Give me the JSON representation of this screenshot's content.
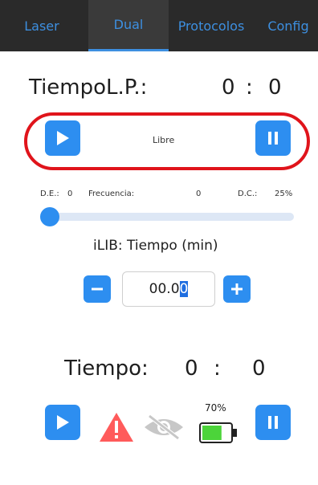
{
  "tabs": [
    {
      "label": "Laser",
      "active": false
    },
    {
      "label": "Dual",
      "active": true
    },
    {
      "label": "Protocolos",
      "active": false
    },
    {
      "label": "Config",
      "active": false
    }
  ],
  "timer_lp": {
    "label": "TiempoL.P.:",
    "minutes": "0",
    "separator": ":",
    "seconds": "0"
  },
  "mode_text": "Libre",
  "settings": {
    "de_label": "D.E.:",
    "de_value": "0",
    "freq_label": "Frecuencia:",
    "freq_value": "0",
    "dc_label": "D.C.:",
    "dc_value": "25%",
    "slider_level": 0
  },
  "ilib": {
    "label": "iLIB: Tiempo (min)",
    "value_prefix": "00.0",
    "value_selected": "0"
  },
  "timer": {
    "label": "Tiempo:",
    "minutes": "0",
    "separator": ":",
    "seconds": "0"
  },
  "battery": {
    "percent_text": "70%",
    "level": 0.7,
    "color": "#4cd43a"
  },
  "colors": {
    "accent": "#2d8ef0",
    "warning": "#ff5b5b",
    "highlight": "#e0141b"
  }
}
